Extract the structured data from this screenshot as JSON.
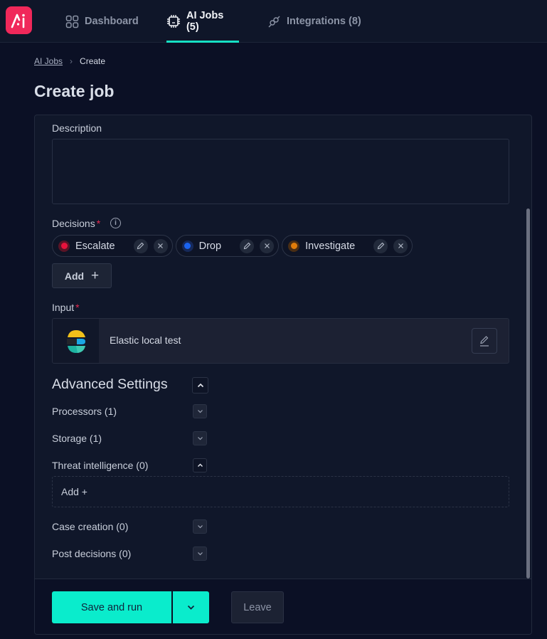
{
  "nav": {
    "logo_text": "AI",
    "items": [
      {
        "label": "Dashboard",
        "icon": "grid-icon",
        "active": false
      },
      {
        "label": "AI Jobs (5)",
        "icon": "chip-icon",
        "active": true
      },
      {
        "label": "Integrations (8)",
        "icon": "plug-icon",
        "active": false
      }
    ]
  },
  "breadcrumb": {
    "parent": "AI Jobs",
    "current": "Create"
  },
  "page_title": "Create job",
  "form": {
    "description_label": "Description",
    "description_value": "",
    "decisions_label": "Decisions",
    "required_mark": "*",
    "decisions": [
      {
        "label": "Escalate",
        "color": "#e8123c",
        "ring": "#5a1426"
      },
      {
        "label": "Drop",
        "color": "#1a63f0",
        "ring": "#16295a"
      },
      {
        "label": "Investigate",
        "color": "#e07c0a",
        "ring": "#4a2e14"
      }
    ],
    "add_label": "Add",
    "add_icon": "+",
    "input_label": "Input",
    "input_name": "Elastic local test",
    "advanced_title": "Advanced Settings",
    "sections": [
      {
        "label": "Processors (1)",
        "expanded": false
      },
      {
        "label": "Storage (1)",
        "expanded": false
      },
      {
        "label": "Threat intelligence (0)",
        "expanded": true
      },
      {
        "label": "Case creation (0)",
        "expanded": false
      },
      {
        "label": "Post decisions (0)",
        "expanded": false
      }
    ],
    "threat_add_label": "Add +"
  },
  "footer": {
    "save_label": "Save and run",
    "leave_label": "Leave"
  },
  "colors": {
    "accent": "#0aeccc",
    "tab_underline": "#16e0c5",
    "logo_bg": "#f0285a",
    "required": "#e5294f"
  }
}
